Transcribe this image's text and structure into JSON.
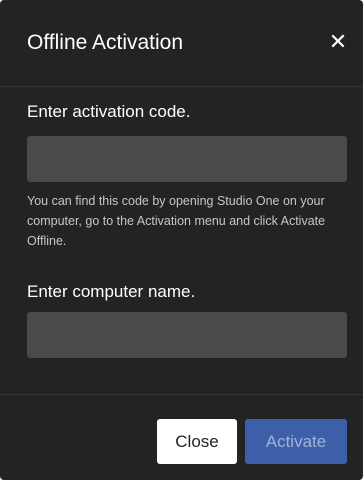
{
  "dialog": {
    "title": "Offline Activation",
    "close_glyph": "✕",
    "close_icon": "close-icon"
  },
  "activation_code": {
    "label": "Enter activation code.",
    "value": "",
    "placeholder": "",
    "hint": "You can find this code by opening Studio One on your computer, go to the Activation menu and click Activate Offline."
  },
  "computer_name": {
    "label": "Enter computer name.",
    "value": "",
    "placeholder": ""
  },
  "buttons": {
    "close_label": "Close",
    "activate_label": "Activate"
  },
  "colors": {
    "dialog_background": "#232323",
    "input_background": "#4a4a4a",
    "primary_button": "#3d5ea8",
    "primary_button_text": "#9fb3dc",
    "secondary_button": "#ffffff"
  }
}
